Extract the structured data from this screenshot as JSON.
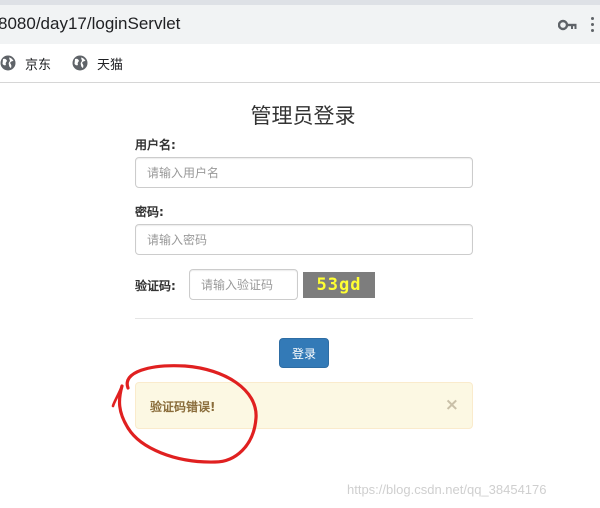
{
  "browser": {
    "url": "8080/day17/loginServlet",
    "bookmarks": [
      {
        "label": "京东",
        "icon": "globe-icon"
      },
      {
        "label": "天猫",
        "icon": "globe-icon"
      }
    ]
  },
  "login": {
    "title": "管理员登录",
    "username": {
      "label": "用户名:",
      "placeholder": "请输入用户名",
      "value": ""
    },
    "password": {
      "label": "密码:",
      "placeholder": "请输入密码",
      "value": ""
    },
    "captcha": {
      "label": "验证码:",
      "placeholder": "请输入验证码",
      "image_text": "53gd"
    },
    "submit_label": "登录",
    "alert": {
      "message": "验证码错误!",
      "close": "×"
    }
  },
  "watermark": "https://blog.csdn.net/qq_38454176",
  "colors": {
    "primary": "#337ab7",
    "alert_bg": "#fcf8e3",
    "alert_text": "#8a6d3b",
    "captcha_bg": "#7d7d7d",
    "captcha_text": "#ffff33",
    "annotation": "#e02020"
  }
}
